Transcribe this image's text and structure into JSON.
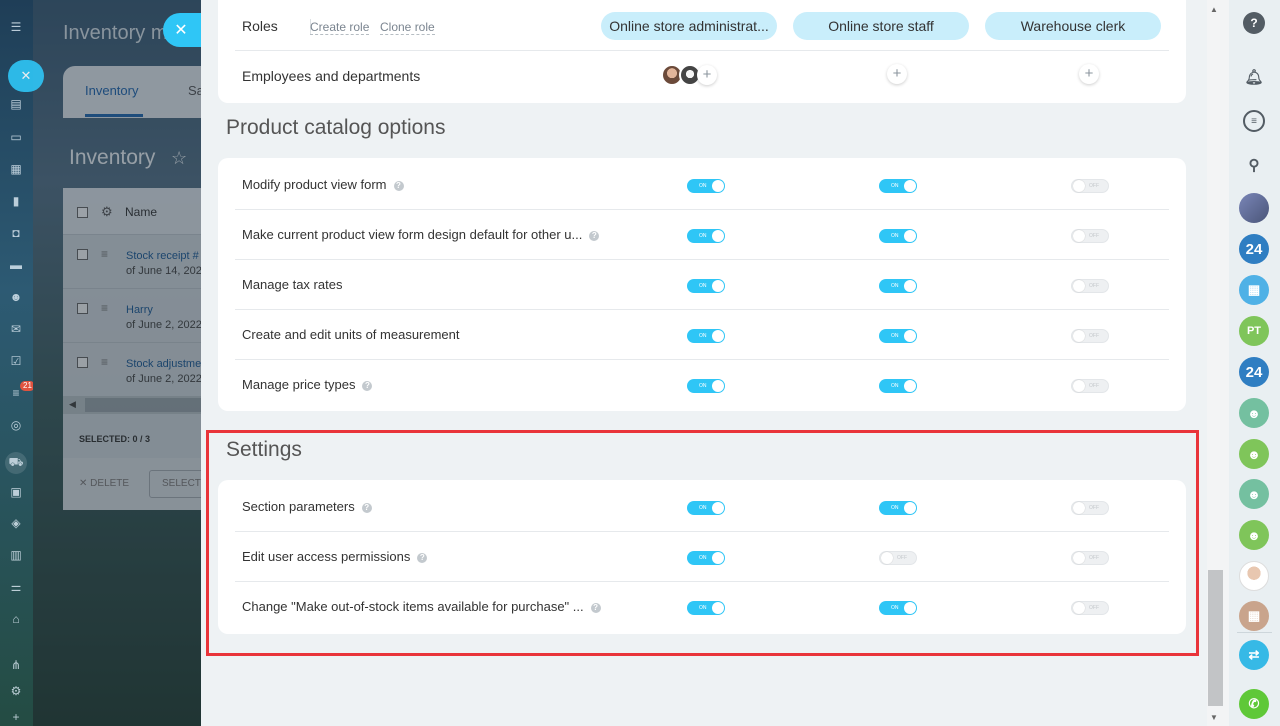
{
  "background_app": {
    "title": "Inventory m",
    "tabs": [
      "Inventory",
      "Sa"
    ],
    "heading": "Inventory",
    "table": {
      "column": "Name",
      "rows": [
        {
          "link": "Stock receipt #",
          "sub": "of June 14, 2022"
        },
        {
          "link": "Harry",
          "sub": "of June 2, 2022"
        },
        {
          "link": "Stock adjustme",
          "sub": "of June 2, 2022"
        }
      ],
      "selected": "SELECTED: 0 / 3",
      "delete_label": "DELETE",
      "select_label": "SELECT"
    },
    "notification_badge": "21"
  },
  "roles_header": {
    "label": "Roles",
    "create_role": "Create role",
    "clone_role": "Clone role",
    "roles": [
      "Online store administrat...",
      "Online store staff",
      "Warehouse clerk"
    ],
    "employees_label": "Employees and departments"
  },
  "product_catalog": {
    "title": "Product catalog options",
    "rows": [
      {
        "label": "Modify product view form",
        "help": true,
        "values": [
          "ON",
          "ON",
          "OFF"
        ]
      },
      {
        "label": "Make current product view form design default for other u...",
        "help": true,
        "values": [
          "ON",
          "ON",
          "OFF"
        ]
      },
      {
        "label": "Manage tax rates",
        "help": false,
        "values": [
          "ON",
          "ON",
          "OFF"
        ]
      },
      {
        "label": "Create and edit units of measurement",
        "help": false,
        "values": [
          "ON",
          "ON",
          "OFF"
        ]
      },
      {
        "label": "Manage price types",
        "help": true,
        "values": [
          "ON",
          "ON",
          "OFF"
        ]
      }
    ]
  },
  "settings": {
    "title": "Settings",
    "rows": [
      {
        "label": "Section parameters",
        "help": true,
        "values": [
          "ON",
          "ON",
          "OFF"
        ]
      },
      {
        "label": "Edit user access permissions",
        "help": true,
        "values": [
          "ON",
          "OFF",
          "OFF"
        ]
      },
      {
        "label": "Change \"Make out-of-stock items available for purchase\" ...",
        "help": true,
        "values": [
          "ON",
          "ON",
          "OFF"
        ]
      }
    ]
  },
  "right_sidebar": {
    "items": [
      "help-icon",
      "bell-icon",
      "chat-icon",
      "search-icon",
      "avatar",
      "24",
      "calendar",
      "PT",
      "24",
      "group",
      "group",
      "group",
      "group",
      "avatar",
      "calendar",
      "transfer",
      "phone"
    ]
  },
  "colors": {
    "accent": "#2fc6f6",
    "highlight": "#e9343a",
    "role_pill": "#c9eefb"
  }
}
